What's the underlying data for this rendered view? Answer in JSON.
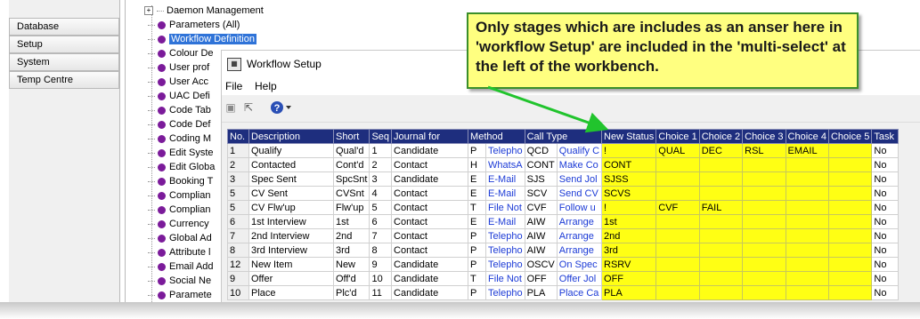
{
  "nav": {
    "items": [
      {
        "label": "Database"
      },
      {
        "label": "Setup"
      },
      {
        "label": "System"
      },
      {
        "label": "Temp Centre"
      }
    ]
  },
  "tree": {
    "top_items": [
      {
        "label": "Daemon Management"
      },
      {
        "label": "Parameters (All)"
      },
      {
        "label": "Workflow Definition"
      }
    ],
    "partial_items": [
      {
        "label": "Colour De"
      },
      {
        "label": "User prof"
      },
      {
        "label": "User Acc"
      },
      {
        "label": "UAC Defi"
      },
      {
        "label": "Code Tab"
      },
      {
        "label": "Code Def"
      },
      {
        "label": "Coding M"
      },
      {
        "label": "Edit Syste"
      },
      {
        "label": "Edit Globa"
      },
      {
        "label": "Booking T"
      },
      {
        "label": "Complian"
      },
      {
        "label": "Complian"
      },
      {
        "label": "Currency"
      },
      {
        "label": "Global Ad"
      },
      {
        "label": "Attribute l"
      },
      {
        "label": "Email Add"
      },
      {
        "label": "Social Ne"
      },
      {
        "label": "Paramete"
      }
    ]
  },
  "workflow_window": {
    "title": "Workflow Setup",
    "menu": {
      "file": "File",
      "help": "Help"
    },
    "columns": [
      "No.",
      "Description",
      "Short",
      "Seq",
      "Journal for",
      "Method",
      "Call Type",
      "",
      "New Status",
      "Choice 1",
      "Choice 2",
      "Choice 3",
      "Choice 4",
      "Choice 5",
      "Task"
    ],
    "rows": [
      [
        "1",
        "Qualify",
        "Qual'd",
        "1",
        "Candidate",
        "P",
        "Telepho",
        "QCD",
        "Qualify C",
        "!",
        "QUAL",
        "DEC",
        "RSL",
        "EMAIL",
        "",
        "No"
      ],
      [
        "2",
        "Contacted",
        "Cont'd",
        "2",
        "Contact",
        "H",
        "WhatsA",
        "CONT",
        "Make Co",
        "CONT",
        "",
        "",
        "",
        "",
        "",
        "No"
      ],
      [
        "3",
        "Spec Sent",
        "SpcSnt",
        "3",
        "Candidate",
        "E",
        "E-Mail",
        "SJS",
        "Send Jol",
        "SJSS",
        "",
        "",
        "",
        "",
        "",
        "No"
      ],
      [
        "5",
        "CV Sent",
        "CVSnt",
        "4",
        "Contact",
        "E",
        "E-Mail",
        "SCV",
        "Send CV",
        "SCVS",
        "",
        "",
        "",
        "",
        "",
        "No"
      ],
      [
        "5",
        "CV Flw'up",
        "Flw'up",
        "5",
        "Contact",
        "T",
        "File Not",
        "CVF",
        "Follow u",
        "!",
        "CVF",
        "FAIL",
        "",
        "",
        "",
        "No"
      ],
      [
        "6",
        "1st Interview",
        "1st",
        "6",
        "Contact",
        "E",
        "E-Mail",
        "AIW",
        "Arrange",
        "1st",
        "",
        "",
        "",
        "",
        "",
        "No"
      ],
      [
        "7",
        "2nd Interview",
        "2nd",
        "7",
        "Contact",
        "P",
        "Telepho",
        "AIW",
        "Arrange",
        "2nd",
        "",
        "",
        "",
        "",
        "",
        "No"
      ],
      [
        "8",
        "3rd Interview",
        "3rd",
        "8",
        "Contact",
        "P",
        "Telepho",
        "AIW",
        "Arrange",
        "3rd",
        "",
        "",
        "",
        "",
        "",
        "No"
      ],
      [
        "12",
        "New Item",
        "New",
        "9",
        "Candidate",
        "P",
        "Telepho",
        "OSCV",
        "On Spec",
        "RSRV",
        "",
        "",
        "",
        "",
        "",
        "No"
      ],
      [
        "9",
        "Offer",
        "Off'd",
        "10",
        "Candidate",
        "T",
        "File Not",
        "OFF",
        "Offer Jol",
        "OFF",
        "",
        "",
        "",
        "",
        "",
        "No"
      ],
      [
        "10",
        "Place",
        "Plc'd",
        "11",
        "Candidate",
        "P",
        "Telepho",
        "PLA",
        "Place Ca",
        "PLA",
        "",
        "",
        "",
        "",
        "",
        "No"
      ]
    ]
  },
  "callout": {
    "text": "Only stages which are includes as an anser here in 'workflow Setup' are included in the 'multi-select' at the left of the workbench."
  },
  "colors": {
    "header_bg": "#1e2e7e",
    "highlight_yellow": "#ffff14",
    "callout_bg": "#ffff80",
    "callout_border": "#3b8f2a",
    "arrow_green": "#21c42d",
    "tree_dot": "#7b1b9a",
    "selection": "#2f73d8"
  },
  "icons": {
    "toolbar": [
      "save-icon",
      "export-icon",
      "help-icon"
    ],
    "window": "workflow-app-icon"
  }
}
